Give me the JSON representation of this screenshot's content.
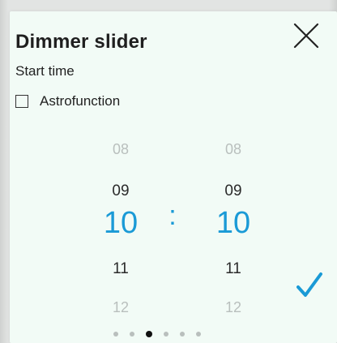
{
  "dialog": {
    "title": "Dimmer slider",
    "subtitle": "Start time",
    "close_icon": "close-icon",
    "confirm_icon": "checkmark-icon"
  },
  "astrofunction": {
    "label": "Astrofunction",
    "checked": false
  },
  "time_picker": {
    "separator": ":",
    "hours": {
      "above_far": "08",
      "above_near": "09",
      "selected": "10",
      "below_near": "11",
      "below_far": "12"
    },
    "minutes": {
      "above_far": "08",
      "above_near": "09",
      "selected": "10",
      "below_near": "11",
      "below_far": "12"
    }
  },
  "page_indicator": {
    "count": 6,
    "active_index": 2
  },
  "colors": {
    "accent": "#1a9ad6",
    "background": "#f2fbf6",
    "text": "#1f1f1f",
    "muted": "#b9bfbd"
  }
}
